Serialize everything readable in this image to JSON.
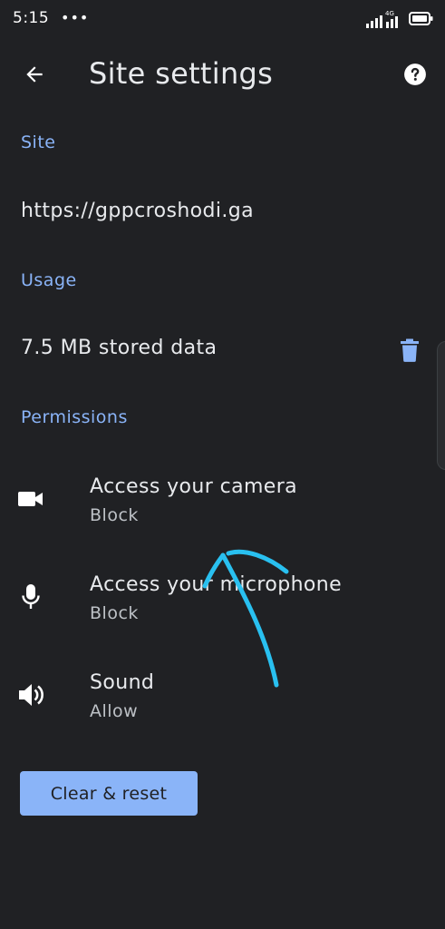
{
  "status_bar": {
    "time": "5:15",
    "notifications_dots": "•••",
    "network_label": "4G"
  },
  "header": {
    "title": "Site settings",
    "back_icon": "arrow-back-icon",
    "help_icon": "help-icon"
  },
  "site": {
    "header": "Site",
    "url": "https://gppcroshodi.ga"
  },
  "usage": {
    "header": "Usage",
    "stored_data": "7.5 MB stored data",
    "delete_icon": "trash-icon"
  },
  "permissions": {
    "header": "Permissions",
    "items": [
      {
        "label": "Access your camera",
        "value": "Block",
        "icon": "camera-icon"
      },
      {
        "label": "Access your microphone",
        "value": "Block",
        "icon": "microphone-icon"
      },
      {
        "label": "Sound",
        "value": "Allow",
        "icon": "speaker-icon"
      }
    ]
  },
  "actions": {
    "clear_reset_label": "Clear & reset"
  },
  "colors": {
    "background": "#202124",
    "accent": "#8ab4f8",
    "annotation": "#29c0f0"
  }
}
